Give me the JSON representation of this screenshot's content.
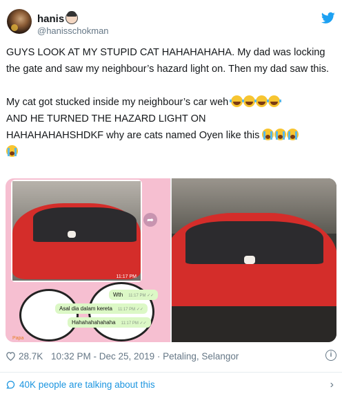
{
  "author": {
    "name": "hanis",
    "handle": "@hanisschokman",
    "badge_icon": "girl-emoji-icon"
  },
  "tweet": {
    "line1": "GUYS LOOK AT MY STUPID CAT HAHAHAHAHA. My dad was locking the gate and saw my neighbour’s hazard light on. Then my dad saw this.",
    "line2a": "My cat got stucked inside my neighbour’s car weh ",
    "line2b": " AND HE TURNED THE HAZARD LIGHT ON",
    "line2c": "HAHAHAHAHSHDKF why are cats named Oyen like this ",
    "emoji_joy": "face-with-tears-of-joy-emoji",
    "emoji_sob": "loudly-crying-face-emoji"
  },
  "media": {
    "left_image_time": "11:17 PM",
    "messages": [
      {
        "text": "Wth",
        "time": "11:17 PM ✓✓"
      },
      {
        "text": "Asal dia dalam kereta",
        "time": "11:17 PM ✓✓"
      },
      {
        "text": "Hahahahahahaha",
        "time": "11:17 PM ✓✓"
      }
    ],
    "chat_name": "Papa",
    "car_color": "#d42d2a",
    "chat_bg": "#f6bfd1"
  },
  "meta": {
    "likes": "28.7K",
    "datetime": "10:32 PM - Dec 25, 2019 · Petaling, Selangor"
  },
  "talking": {
    "label": "40K people are talking about this"
  },
  "colors": {
    "accent": "#1b95e0",
    "meta": "#657786",
    "text": "#14171a"
  }
}
